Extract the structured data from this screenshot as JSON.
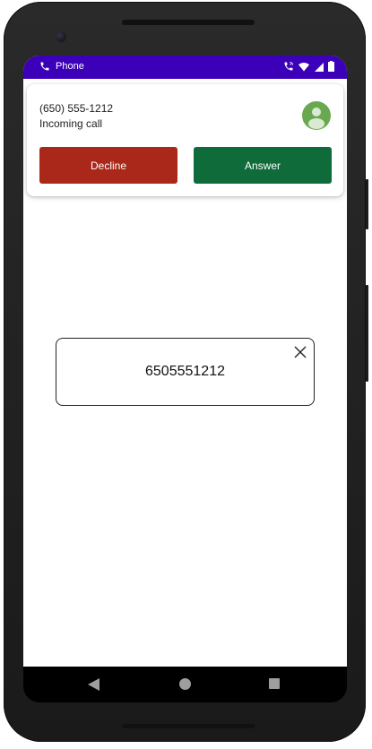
{
  "status_bar": {
    "app_name": "Phone",
    "background_color": "#3b00b8",
    "icons": [
      "phone-icon",
      "wifi-call-icon",
      "wifi-icon",
      "signal-icon",
      "battery-icon"
    ]
  },
  "notification": {
    "caller_number": "(650) 555-1212",
    "call_status": "Incoming call",
    "avatar_icon": "person-icon",
    "avatar_color": "#6aa84f",
    "decline_label": "Decline",
    "decline_color": "#a9281a",
    "answer_label": "Answer",
    "answer_color": "#0f6b3a"
  },
  "number_box": {
    "number": "6505551212",
    "close_icon": "close-icon"
  },
  "nav_bar": {
    "icons": [
      "back-icon",
      "home-icon",
      "recents-icon"
    ]
  }
}
